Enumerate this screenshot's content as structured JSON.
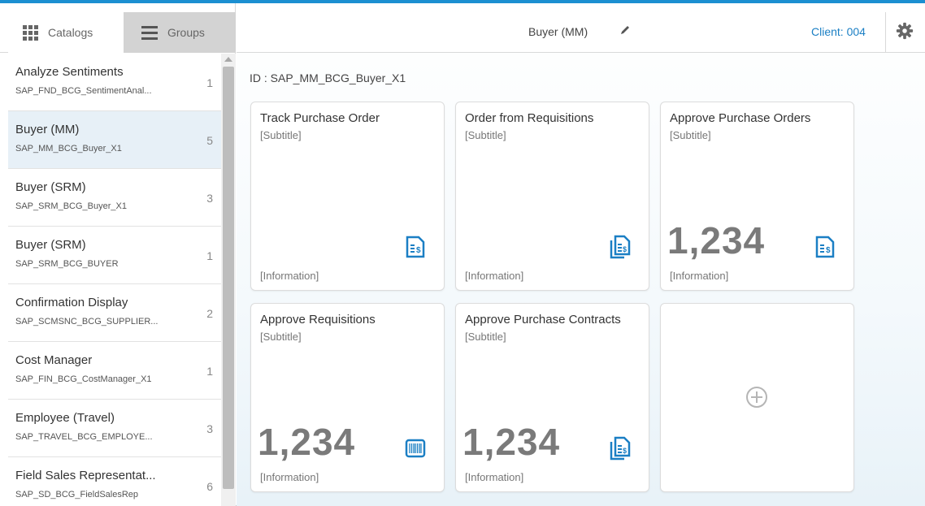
{
  "nav": {
    "catalogs_label": "Catalogs",
    "groups_label": "Groups"
  },
  "groups_list": [
    {
      "title": "Analyze Sentiments",
      "subtitle": "SAP_FND_BCG_SentimentAnal...",
      "count": "1"
    },
    {
      "title": "Buyer (MM)",
      "subtitle": "SAP_MM_BCG_Buyer_X1",
      "count": "5"
    },
    {
      "title": "Buyer (SRM)",
      "subtitle": "SAP_SRM_BCG_Buyer_X1",
      "count": "3"
    },
    {
      "title": "Buyer (SRM)",
      "subtitle": "SAP_SRM_BCG_BUYER",
      "count": "1"
    },
    {
      "title": "Confirmation Display",
      "subtitle": "SAP_SCMSNC_BCG_SUPPLIER...",
      "count": "2"
    },
    {
      "title": "Cost Manager",
      "subtitle": "SAP_FIN_BCG_CostManager_X1",
      "count": "1"
    },
    {
      "title": "Employee (Travel)",
      "subtitle": "SAP_TRAVEL_BCG_EMPLOYE...",
      "count": "3"
    },
    {
      "title": "Field Sales Representat...",
      "subtitle": "SAP_SD_BCG_FieldSalesRep",
      "count": "6"
    }
  ],
  "header": {
    "group_title": "Buyer (MM)",
    "client": "Client: 004"
  },
  "page_id": "ID : SAP_MM_BCG_Buyer_X1",
  "tiles": [
    {
      "title": "Track Purchase Order",
      "subtitle": "[Subtitle]",
      "number": "",
      "info": "[Information]",
      "icon": "invoice-icon"
    },
    {
      "title": "Order from Requisitions",
      "subtitle": "[Subtitle]",
      "number": "",
      "info": "[Information]",
      "icon": "documents-icon"
    },
    {
      "title": "Approve Purchase Orders",
      "subtitle": "[Subtitle]",
      "number": "1,234",
      "info": "[Information]",
      "icon": "invoice-icon"
    },
    {
      "title": "Approve Requisitions",
      "subtitle": "[Subtitle]",
      "number": "1,234",
      "info": "[Information]",
      "icon": "barcode-icon"
    },
    {
      "title": "Approve Purchase Contracts",
      "subtitle": "[Subtitle]",
      "number": "1,234",
      "info": "[Information]",
      "icon": "documents-icon"
    }
  ],
  "colors": {
    "accent": "#1b8fd1",
    "icon_blue": "#1b7fc4",
    "selected_row": "#e7f0f7"
  }
}
